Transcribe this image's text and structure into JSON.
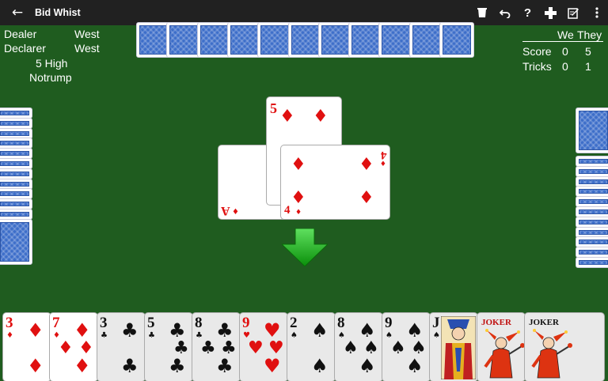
{
  "app": {
    "title": "Bid Whist"
  },
  "toolbar": {
    "back_icon": "arrow-back-icon",
    "icons": [
      "trash-icon",
      "undo-icon",
      "help-icon",
      "gamepad-icon",
      "edit-icon",
      "more-vert-icon"
    ]
  },
  "game_info": {
    "dealer_label": "Dealer",
    "dealer_value": "West",
    "declarer_label": "Declarer",
    "declarer_value": "West",
    "bid": "5 High",
    "trump": "Notrump"
  },
  "scoreboard": {
    "col_we": "We",
    "col_they": "They",
    "score_label": "Score",
    "score_we": "0",
    "score_they": "5",
    "tricks_label": "Tricks",
    "tricks_we": "0",
    "tricks_they": "1"
  },
  "trick": [
    {
      "rank": "A",
      "suit": "♦",
      "color": "red"
    },
    {
      "rank": "5",
      "suit": "♦",
      "color": "red"
    },
    {
      "rank": "4",
      "suit": "♦",
      "color": "red"
    }
  ],
  "hand": [
    {
      "rank": "3",
      "suit": "♦",
      "color": "red"
    },
    {
      "rank": "7",
      "suit": "♦",
      "color": "red"
    },
    {
      "rank": "3",
      "suit": "♣",
      "color": "black"
    },
    {
      "rank": "5",
      "suit": "♣",
      "color": "black"
    },
    {
      "rank": "8",
      "suit": "♣",
      "color": "black"
    },
    {
      "rank": "9",
      "suit": "♥",
      "color": "red"
    },
    {
      "rank": "2",
      "suit": "♠",
      "color": "black"
    },
    {
      "rank": "8",
      "suit": "♠",
      "color": "black"
    },
    {
      "rank": "9",
      "suit": "♠",
      "color": "black"
    },
    {
      "rank": "J",
      "suit": "♠",
      "color": "black"
    },
    {
      "rank": "JOKER",
      "suit": "",
      "color": "red"
    },
    {
      "rank": "JOKER",
      "suit": "",
      "color": "black"
    }
  ],
  "colors": {
    "felt": "#1f5c1f",
    "card_back": "#3d6ec9",
    "suit_red": "#e01010",
    "arrow": "#22bb22"
  }
}
